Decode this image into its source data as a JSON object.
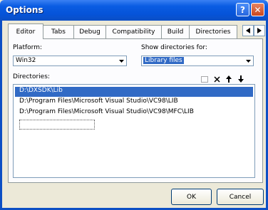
{
  "window": {
    "title": "Options",
    "help_icon": "help-icon",
    "close_icon": "close-icon"
  },
  "tabs": [
    {
      "label": "Editor",
      "active": true
    },
    {
      "label": "Tabs",
      "active": false
    },
    {
      "label": "Debug",
      "active": false
    },
    {
      "label": "Compatibility",
      "active": false
    },
    {
      "label": "Build",
      "active": false
    },
    {
      "label": "Directories",
      "active": false
    }
  ],
  "platform": {
    "label": "Platform:",
    "value": "Win32"
  },
  "show_dirs": {
    "label": "Show directories for:",
    "value": "Library files"
  },
  "directories": {
    "label": "Directories:",
    "items": [
      {
        "path": "D:\\DXSDK\\Lib",
        "selected": true
      },
      {
        "path": "D:\\Program Files\\Microsoft Visual Studio\\VC98\\LIB",
        "selected": false
      },
      {
        "path": "D:\\Program Files\\Microsoft Visual Studio\\VC98\\MFC\\LIB",
        "selected": false
      }
    ]
  },
  "buttons": {
    "ok": "OK",
    "cancel": "Cancel"
  },
  "colors": {
    "titlebar": "#0553d8",
    "selection": "#316ac5",
    "face": "#ece9d8"
  }
}
